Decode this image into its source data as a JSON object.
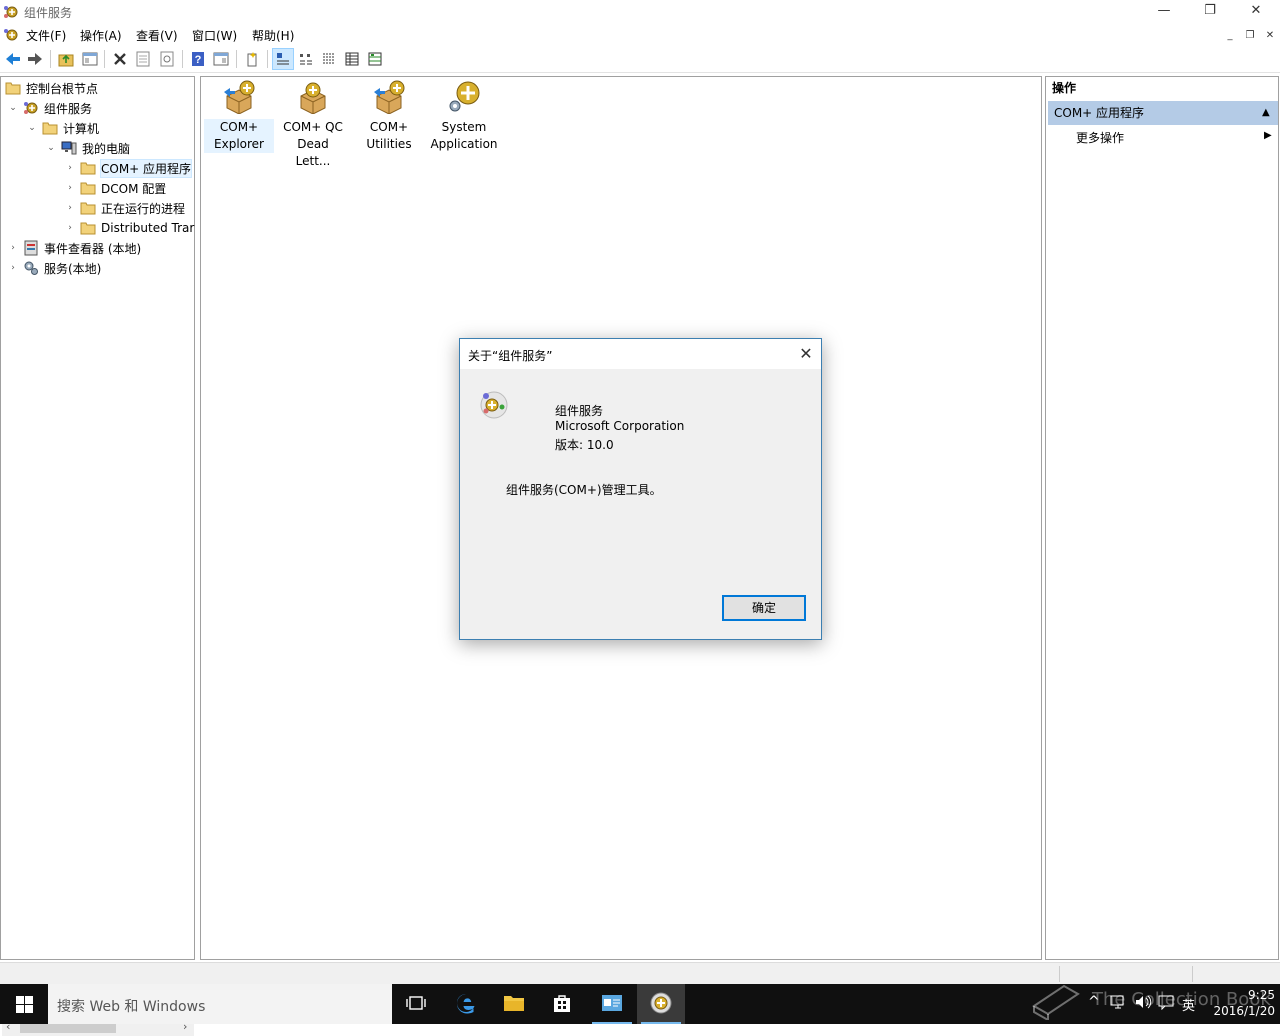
{
  "window": {
    "title": "组件服务",
    "min_glyph": "—",
    "restore_glyph": "❐",
    "close_glyph": "✕"
  },
  "menu": {
    "items": [
      "文件(F)",
      "操作(A)",
      "查看(V)",
      "窗口(W)",
      "帮助(H)"
    ],
    "mdi": {
      "min": "_",
      "restore": "❐",
      "close": "✕"
    }
  },
  "tree": {
    "nodes": [
      {
        "label": "控制台根节点",
        "icon": "folder-icon"
      },
      {
        "label": "组件服务",
        "icon": "component-services-icon"
      },
      {
        "label": "计算机",
        "icon": "folder-icon"
      },
      {
        "label": "我的电脑",
        "icon": "computer-icon"
      },
      {
        "label": "COM+ 应用程序",
        "icon": "folder-icon"
      },
      {
        "label": "DCOM 配置",
        "icon": "folder-icon"
      },
      {
        "label": "正在运行的进程",
        "icon": "folder-icon"
      },
      {
        "label": "Distributed Trar",
        "icon": "folder-icon"
      },
      {
        "label": "事件查看器 (本地)",
        "icon": "event-viewer-icon"
      },
      {
        "label": "服务(本地)",
        "icon": "services-icon"
      }
    ]
  },
  "content": {
    "items": [
      {
        "line1": "COM+",
        "line2": "Explorer",
        "icon": "com-plus-package-icon"
      },
      {
        "line1": "COM+ QC",
        "line2": "Dead Lett...",
        "icon": "com-plus-package-icon"
      },
      {
        "line1": "COM+",
        "line2": "Utilities",
        "icon": "com-plus-package-icon"
      },
      {
        "line1": "System",
        "line2": "Application",
        "icon": "system-application-icon"
      }
    ]
  },
  "actions": {
    "header": "操作",
    "section": "COM+ 应用程序",
    "more": "更多操作"
  },
  "dialog": {
    "title": "关于“组件服务”",
    "product": "组件服务",
    "company": "Microsoft Corporation",
    "version": "版本: 10.0",
    "description": "组件服务(COM+)管理工具。",
    "ok": "确定"
  },
  "taskbar": {
    "search_placeholder": "搜索 Web 和 Windows",
    "ime": "英",
    "time": "9:25",
    "date": "2016/1/20",
    "watermark": "The Collection Book"
  },
  "colors": {
    "accent": "#0078d7",
    "selection": "#cce8ff",
    "action_header": "#b4cbe6",
    "taskbar": "#101010"
  }
}
